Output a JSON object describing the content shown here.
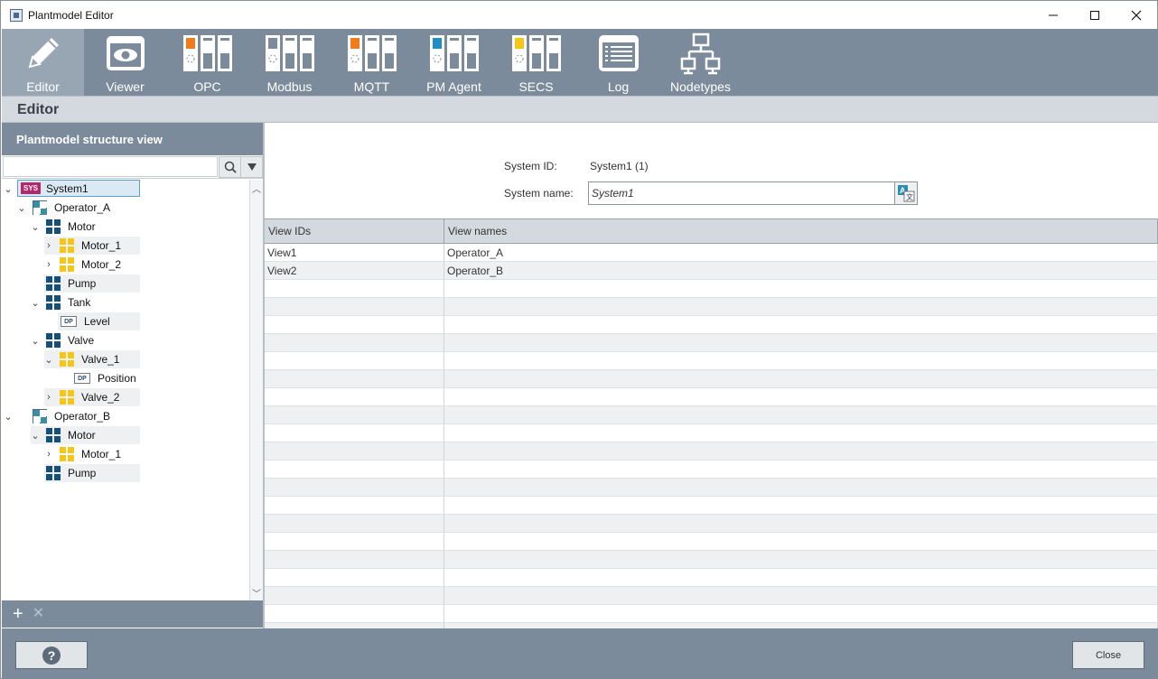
{
  "window": {
    "title": "Plantmodel Editor",
    "minimize_icon": "minimize-icon",
    "maximize_icon": "maximize-icon",
    "close_icon": "close-icon"
  },
  "toolbar": {
    "items": [
      {
        "label": "Editor",
        "icon": "pencil-icon",
        "active": true
      },
      {
        "label": "Viewer",
        "icon": "eye-window-icon"
      },
      {
        "label": "OPC",
        "icon": "server-rack-icon",
        "accent": "#f07c1e"
      },
      {
        "label": "Modbus",
        "icon": "server-rack-icon",
        "accent": "#ffffff"
      },
      {
        "label": "MQTT",
        "icon": "server-rack-icon",
        "accent": "#f07c1e"
      },
      {
        "label": "PM Agent",
        "icon": "server-rack-icon",
        "accent": "#1f8ec6"
      },
      {
        "label": "SECS",
        "icon": "server-rack-icon",
        "accent": "#f5c518"
      },
      {
        "label": "Log",
        "icon": "log-list-icon"
      },
      {
        "label": "Nodetypes",
        "icon": "network-tree-icon"
      }
    ]
  },
  "section": {
    "title": "Editor"
  },
  "left": {
    "title": "Plantmodel structure view",
    "search": {
      "value": "",
      "placeholder": ""
    },
    "tree": [
      {
        "label": "System1",
        "type": "sys",
        "level": 0,
        "expanded": true,
        "selected": true
      },
      {
        "label": "Operator_A",
        "type": "op",
        "level": 1,
        "expanded": true
      },
      {
        "label": "Motor",
        "type": "blue",
        "level": 2,
        "expanded": true
      },
      {
        "label": "Motor_1",
        "type": "yellow",
        "level": 3,
        "expanded": false
      },
      {
        "label": "Motor_2",
        "type": "yellow",
        "level": 3,
        "expanded": false
      },
      {
        "label": "Pump",
        "type": "blue",
        "level": 2
      },
      {
        "label": "Tank",
        "type": "blue",
        "level": 2,
        "expanded": true
      },
      {
        "label": "Level",
        "type": "dp",
        "level": 3
      },
      {
        "label": "Valve",
        "type": "blue",
        "level": 2,
        "expanded": true
      },
      {
        "label": "Valve_1",
        "type": "yellow",
        "level": 3,
        "expanded": true
      },
      {
        "label": "Position",
        "type": "dp",
        "level": 4
      },
      {
        "label": "Valve_2",
        "type": "yellow",
        "level": 3,
        "expanded": false
      },
      {
        "label": "Operator_B",
        "type": "op",
        "level": 1,
        "expanded": true
      },
      {
        "label": "Motor",
        "type": "blue",
        "level": 2,
        "expanded": true
      },
      {
        "label": "Motor_1",
        "type": "yellow",
        "level": 3,
        "expanded": false
      },
      {
        "label": "Pump",
        "type": "blue",
        "level": 2
      }
    ],
    "footer": {
      "add_label": "+",
      "remove_label": "✕"
    }
  },
  "detail": {
    "system_id_label": "System ID:",
    "system_id_value": "System1 (1)",
    "system_name_label": "System name:",
    "system_name_value": "System1",
    "table": {
      "columns": [
        "View IDs",
        "View names"
      ],
      "rows": [
        [
          "View1",
          "Operator_A"
        ],
        [
          "View2",
          "Operator_B"
        ]
      ]
    }
  },
  "footer": {
    "help_label": "?",
    "close_label": "Close"
  },
  "colors": {
    "toolbar": "#7c8b9c",
    "active_tool": "#98a5b3",
    "sys_badge": "#b32a6b",
    "node_blue": "#14507a",
    "node_yellow": "#f5c518"
  }
}
